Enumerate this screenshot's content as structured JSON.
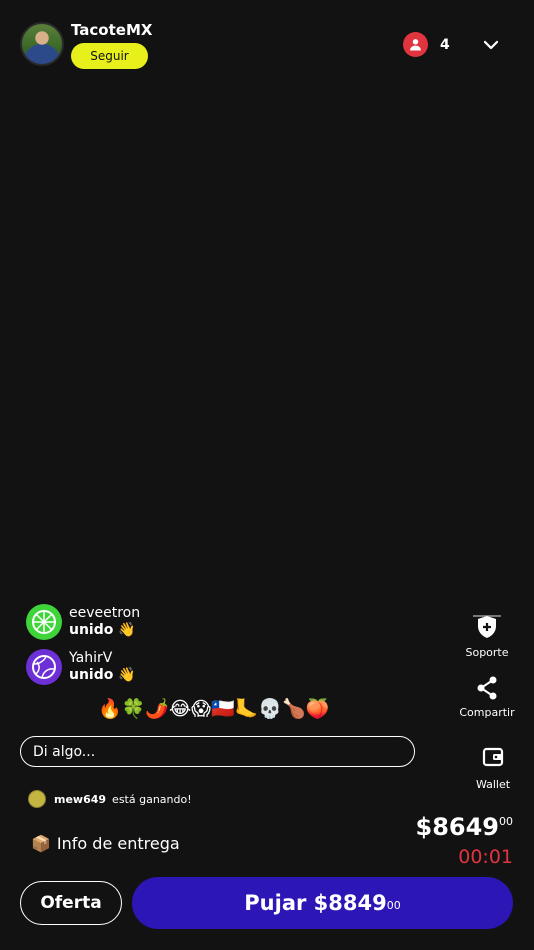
{
  "header": {
    "username": "TacoteMX",
    "follow_label": "Seguir",
    "viewer_count": "4"
  },
  "chat": {
    "events": [
      {
        "name": "eeveetron",
        "status": "unido 👋",
        "avatar_color": "#3fd43a"
      },
      {
        "name": "YahirV",
        "status": "unido 👋",
        "avatar_color": "#6d2fd6"
      }
    ],
    "emojis": "🔥🍀🌶️😂😱🇨🇱🦶💀🍗🍑",
    "input_placeholder": "Di algo..."
  },
  "auction": {
    "winner_name": "mew649",
    "winner_text": "está ganando!",
    "delivery_icon": "📦",
    "delivery_label": "Info de entrega",
    "price_main": "$8649",
    "price_cents": "00",
    "timer": "00:01",
    "offer_label": "Oferta",
    "bid_label": "Pujar $8849",
    "bid_cents": "00"
  },
  "rail": {
    "support_label": "Soporte",
    "share_label": "Compartir",
    "wallet_label": "Wallet"
  },
  "colors": {
    "background": "#121212",
    "follow": "#e7f01a",
    "accent_red": "#e0343f",
    "bid_button": "#2c16b6"
  }
}
